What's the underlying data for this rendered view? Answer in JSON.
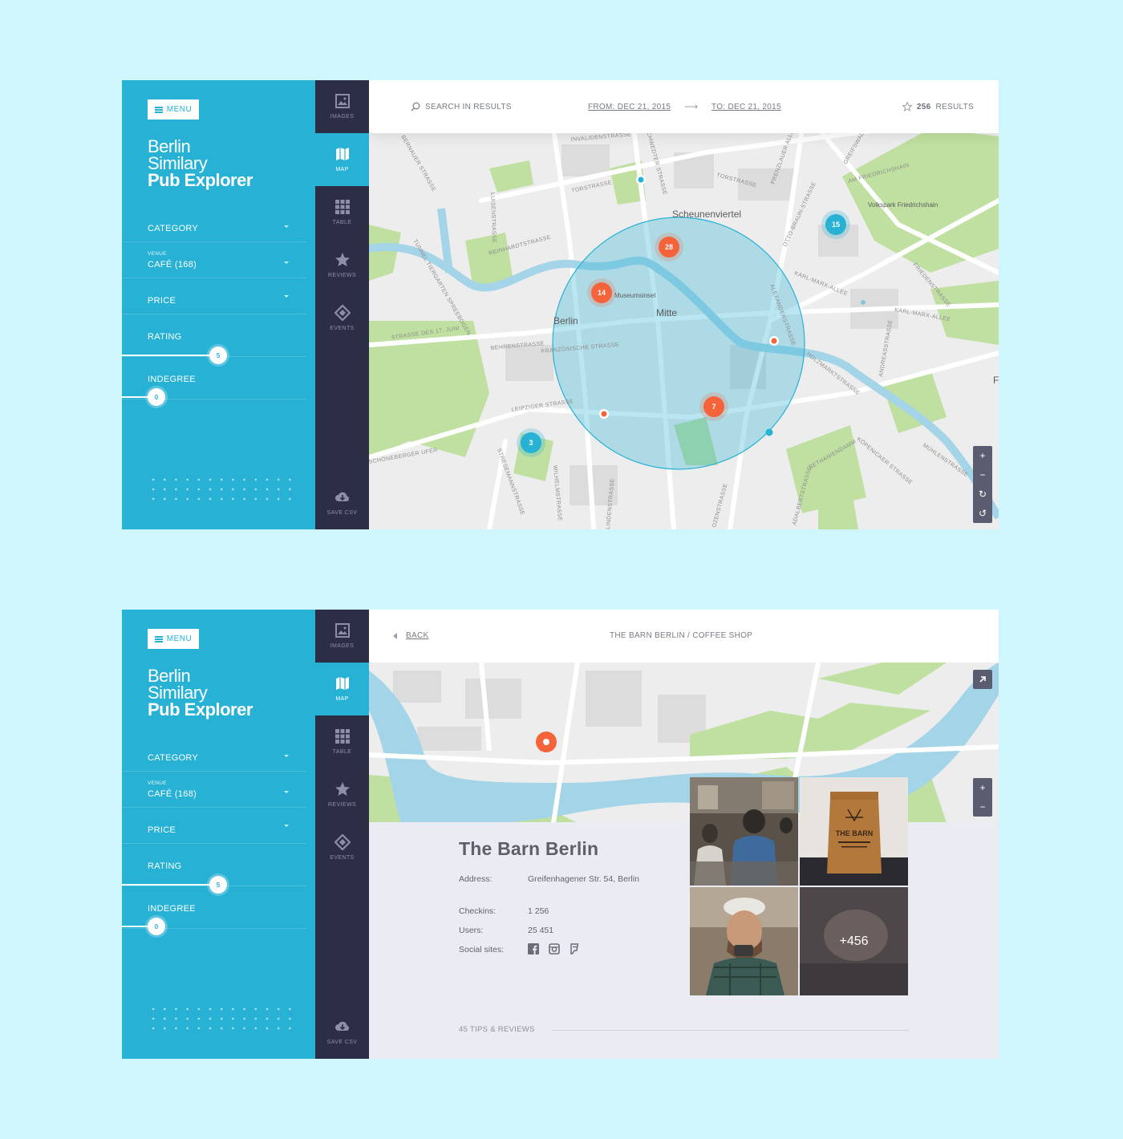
{
  "sidebar": {
    "menu_label": "MENU",
    "title_lines": [
      "Berlin",
      "Similary",
      "Pub Explorer"
    ],
    "filters": {
      "category": "CATEGORY",
      "venue_sub": "VENUE",
      "venue_value": "CAFÉ (168)",
      "price": "PRICE",
      "rating": "RATING",
      "rating_value": "5",
      "indegree": "INDEGREE",
      "indegree_value": "0"
    }
  },
  "nav": {
    "items": [
      {
        "label": "IMAGES",
        "icon": "image-icon"
      },
      {
        "label": "MAP",
        "icon": "map-icon"
      },
      {
        "label": "TABLE",
        "icon": "table-icon"
      },
      {
        "label": "REVIEWS",
        "icon": "star-icon"
      },
      {
        "label": "EVENTS",
        "icon": "ticket-icon"
      }
    ],
    "active": "MAP",
    "save_label": "SAVE CSV"
  },
  "search_bar": {
    "placeholder": "SEARCH IN RESULTS",
    "from": "FROM: DEC 21, 2015",
    "to": "TO: DEC 21, 2015",
    "results_count": "256",
    "results_suffix": "RESULTS"
  },
  "map": {
    "streets": [
      "INVALIDENSTRASSE",
      "TORSTRASSE",
      "TORSTRASSE",
      "SCHWEDTER STRASSE",
      "PRENZLAUER ALLEE",
      "GREIFSWALD",
      "AM FRIEDRICHSHAIN",
      "OTTO-BRAUN-STRASSE",
      "KARL-MARX-ALLEE",
      "KARL-MARX-ALLEE",
      "FRIEDENSTRASSE",
      "LUISENSTRASSE",
      "REINHARDTSTRASSE",
      "TUNNEL TIERGARTEN SPREEBOGEN",
      "STRASSE DES 17. JUNI",
      "BEHRENSTRASSE",
      "FRANZÖSISCHE STRASSE",
      "ALEXANDERSTRASSE",
      "HOLZMARKTSTRASSE",
      "ANDREASSTRASSE",
      "LEIPZIGER STRASSE",
      "SCHÖNEBERGER UFER",
      "STRESEMANNSTRASSE",
      "WILHELMSTRASSE",
      "LINDENSTRASSE",
      "BETHANIENDAMM",
      "KÖPENICKER STRASSE",
      "MÜHLENSTRASSE",
      "ADALBERTSTRASSE",
      "OZENSTRASSE",
      "BERNAUER STRASSE"
    ],
    "places": [
      "Scheunenviertel",
      "Berlin",
      "Mitte",
      "Museumsinsel",
      "Volkspark Friedrichshain"
    ],
    "clusters": [
      {
        "count": "28",
        "color": "#f4633a"
      },
      {
        "count": "14",
        "color": "#f4633a"
      },
      {
        "count": "7",
        "color": "#f4633a"
      },
      {
        "count": "15",
        "color": "#27b1d4"
      },
      {
        "count": "3",
        "color": "#27b1d4"
      }
    ],
    "zoom_controls": [
      "+",
      "−",
      "↻",
      "↺"
    ],
    "edge_label": "F"
  },
  "detail": {
    "back_label": "BACK",
    "breadcrumb": "THE BARN BERLIN / COFFEE SHOP",
    "name": "The Barn Berlin",
    "address_label": "Address:",
    "address_value": "Greifenhagener Str. 54, Berlin",
    "checkins_label": "Checkins:",
    "checkins_value": "1 256",
    "users_label": "Users:",
    "users_value": "25 451",
    "social_label": "Social sites:",
    "social_icons": [
      "facebook-icon",
      "instagram-icon",
      "foursquare-icon"
    ],
    "photos_more": "+456",
    "tips_label": "45 TIPS & REVIEWS",
    "zoom_controls": [
      "+",
      "−"
    ],
    "bag_text": "THE BARN"
  },
  "colors": {
    "accent": "#27b1d4",
    "nav_bg": "#2c2e45",
    "marker_orange": "#f4633a",
    "page_bg": "#cff6fd"
  }
}
